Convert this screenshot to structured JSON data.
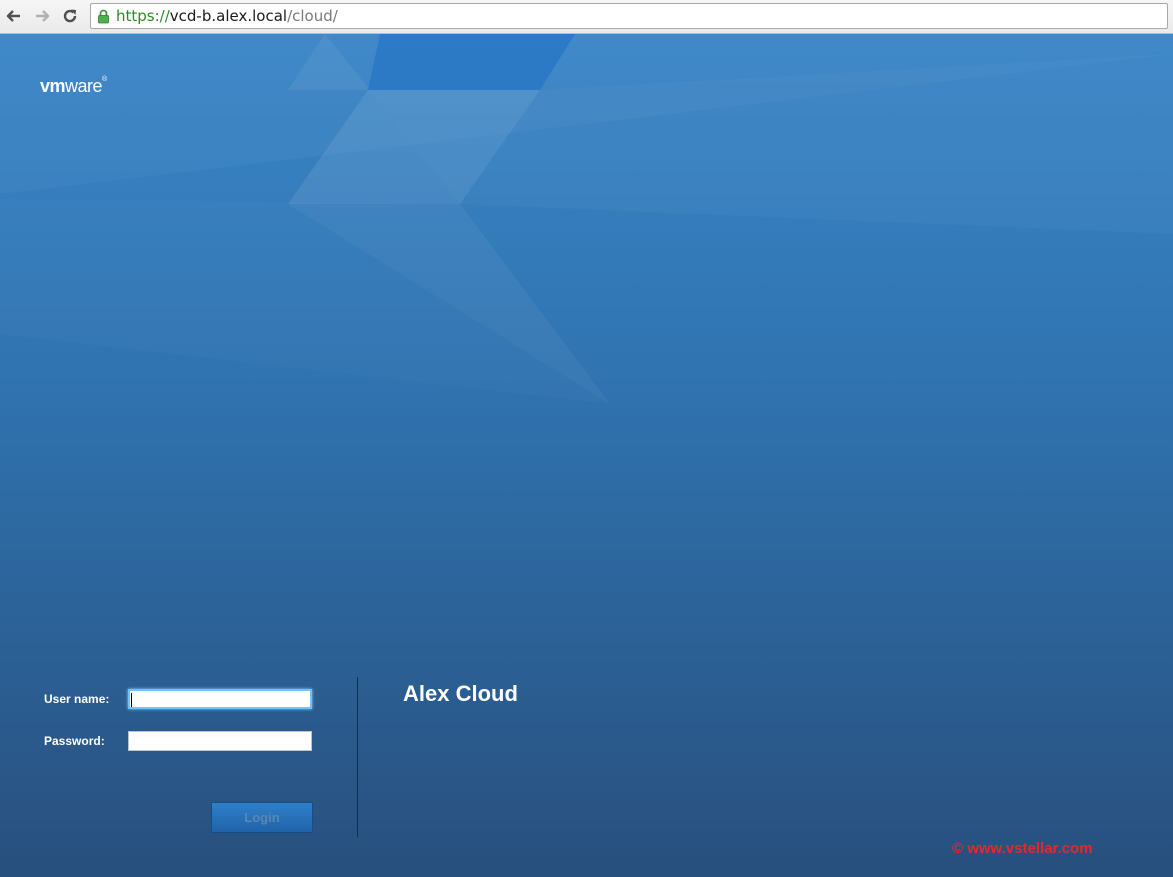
{
  "browser": {
    "url_scheme": "https://",
    "url_host": "vcd-b.alex.local",
    "url_path": "/cloud/",
    "icons": [
      "back-arrow-icon",
      "forward-arrow-icon",
      "reload-icon",
      "lock-icon"
    ]
  },
  "brand": {
    "logo_vm": "vm",
    "logo_ware": "ware",
    "logo_tm": "®"
  },
  "login": {
    "username_label": "User name:",
    "password_label": "Password:",
    "username_value": "",
    "password_value": "",
    "login_button": "Login"
  },
  "organization": {
    "name": "Alex Cloud"
  },
  "watermark": {
    "text": "© www.vstellar.com"
  },
  "colors": {
    "background_top": "#3a86c8",
    "background_bottom": "#284f7d",
    "focus_ring": "#6fc3ff",
    "watermark": "#e8262d"
  }
}
